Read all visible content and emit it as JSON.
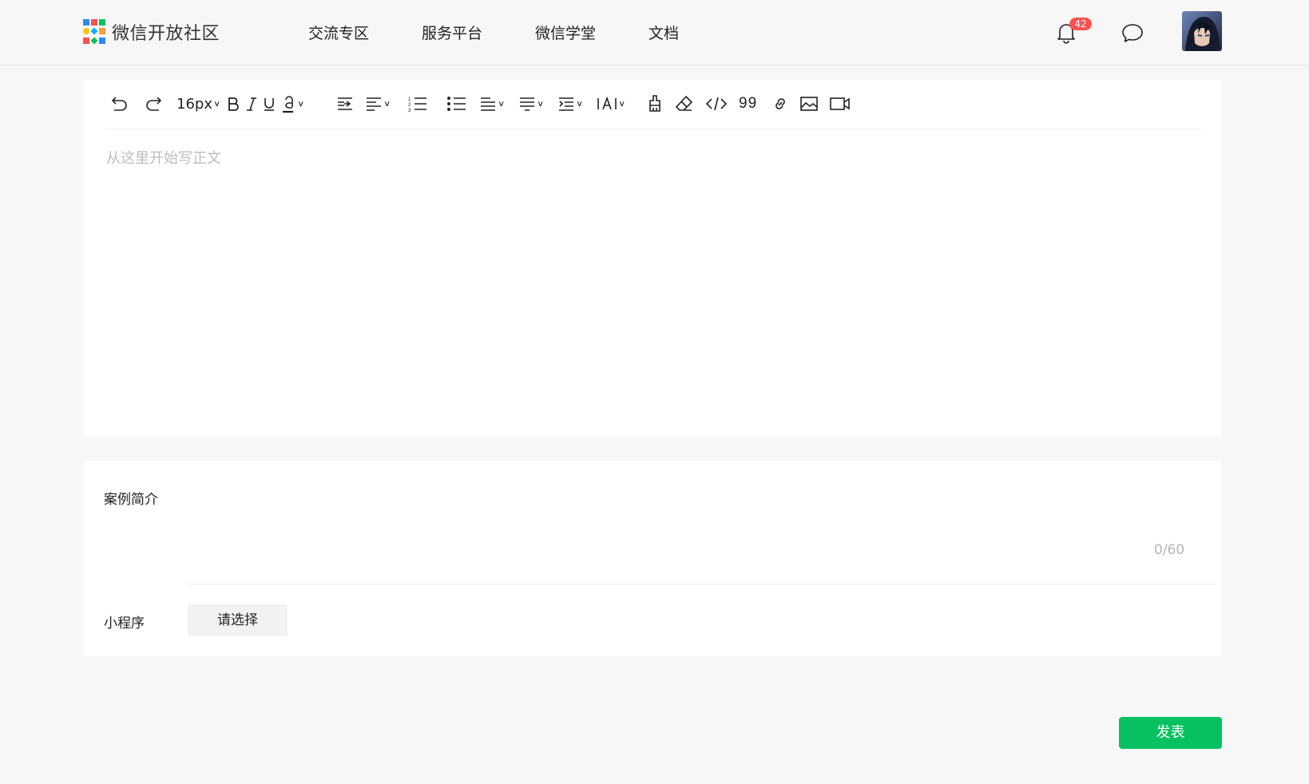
{
  "header": {
    "logo_text": "微信开放社区",
    "nav": [
      "交流专区",
      "服务平台",
      "微信学堂",
      "文档"
    ],
    "notification_count": "42",
    "avatar_alt": "用户头像"
  },
  "colors": {
    "accent": "#07c160",
    "badge": "#fa5151",
    "logo_cells": [
      "#2b8bf2",
      "#fa5151",
      "#07c160",
      "#ffc300",
      "#10aeff",
      "#fa9d3b",
      "#fa5151",
      "#07c160",
      "#2b8bf2"
    ]
  },
  "editor": {
    "font_size": "16px",
    "placeholder": "从这里开始写正文",
    "toolbar": [
      "undo-icon",
      "redo-icon",
      "font-size-select",
      "bold-icon",
      "italic-icon",
      "underline-icon",
      "font-color-icon",
      "indent-icon",
      "align-left-icon",
      "ordered-list-icon",
      "bullet-list-icon",
      "line-height-icon",
      "paragraph-spacing-icon",
      "letter-spacing-icon",
      "text-style-icon",
      "format-painter-icon",
      "eraser-icon",
      "code-icon",
      "quote-icon",
      "link-icon",
      "image-icon",
      "video-icon"
    ]
  },
  "form": {
    "intro_label": "案例简介",
    "intro_value": "",
    "intro_count": "0/60",
    "miniprogram_label": "小程序",
    "miniprogram_select": "请选择"
  },
  "publish_label": "发表"
}
